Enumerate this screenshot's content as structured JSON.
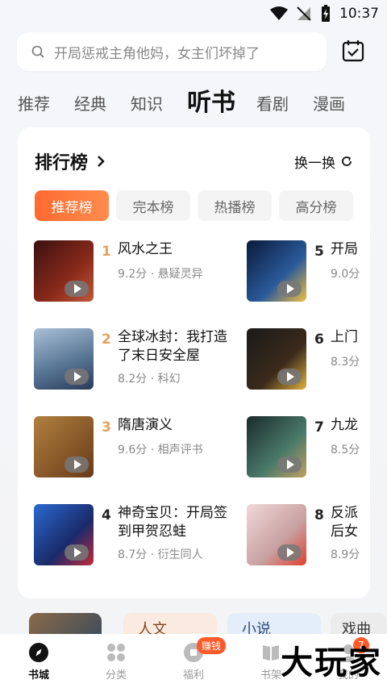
{
  "status": {
    "time": "10:37"
  },
  "search": {
    "placeholder": "开局惩戒主角他妈，女主们坏掉了"
  },
  "tabs": [
    {
      "label": "推荐"
    },
    {
      "label": "经典"
    },
    {
      "label": "知识"
    },
    {
      "label": "听书"
    },
    {
      "label": "看剧"
    },
    {
      "label": "漫画"
    }
  ],
  "ranking": {
    "title": "排行榜",
    "refresh_label": "换一换",
    "chips": [
      {
        "label": "推荐榜"
      },
      {
        "label": "完本榜"
      },
      {
        "label": "热播榜"
      },
      {
        "label": "高分榜"
      }
    ],
    "items": [
      {
        "rank": "1",
        "name": "风水之王",
        "meta": "9.2分 · 悬疑灵异",
        "color": "#6a2a22"
      },
      {
        "rank": "2",
        "name": "全球冰封：我打造了末日安全屋",
        "meta": "8.2分 · 科幻",
        "color": "#5a7896"
      },
      {
        "rank": "3",
        "name": "隋唐演义",
        "meta": "9.6分 · 相声评书",
        "color": "#8a5a2a"
      },
      {
        "rank": "4",
        "name": "神奇宝贝：开局签到甲贺忍蛙",
        "meta": "8.7分 · 衍生同人",
        "color": "#1a3a8a"
      },
      {
        "rank": "5",
        "name": "开局",
        "meta": "9.0分",
        "color": "#2a4a7a"
      },
      {
        "rank": "6",
        "name": "上门",
        "meta": "8.3分",
        "color": "#2a2a2a"
      },
      {
        "rank": "7",
        "name": "九龙",
        "meta": "8.5分",
        "color": "#3a5a4a"
      },
      {
        "rank": "8",
        "name": "反派后女",
        "meta": "8.9分",
        "color": "#c8a0a0"
      }
    ]
  },
  "peek": {
    "tag1": "人文",
    "tag2": "小说",
    "tag3": "戏曲"
  },
  "nav": {
    "items": [
      {
        "label": "书城"
      },
      {
        "label": "分类"
      },
      {
        "label": "福利"
      },
      {
        "label": "书架"
      },
      {
        "label": "我的"
      }
    ],
    "welfare_badge": "赚钱",
    "mine_badge": "7"
  },
  "watermark": "大玩家"
}
